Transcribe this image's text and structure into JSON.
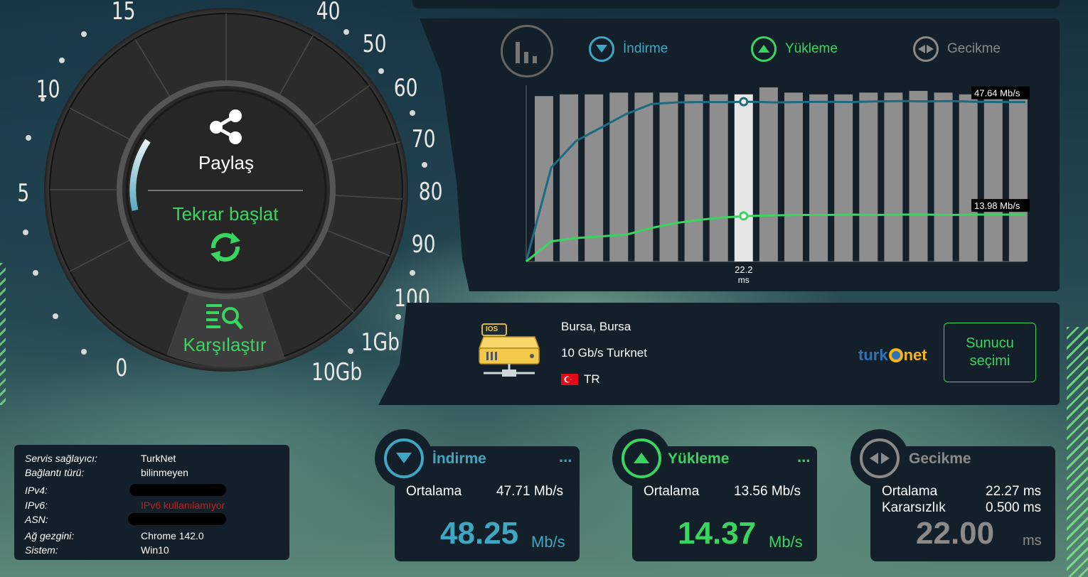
{
  "gauge": {
    "ticks": [
      "0",
      "5",
      "10",
      "15",
      "40",
      "50",
      "60",
      "70",
      "80",
      "90",
      "100",
      "1Gb",
      "10Gb"
    ],
    "share_label": "Paylaş",
    "restart_label": "Tekrar başlat",
    "compare_label": "Karşılaştır"
  },
  "chart_tabs": {
    "download": "İndirme",
    "upload": "Yükleme",
    "latency": "Gecikme"
  },
  "chart_data": {
    "type": "bar",
    "bars": 20,
    "bar_values": [
      0.95,
      0.96,
      0.96,
      0.97,
      0.97,
      0.97,
      0.96,
      0.96,
      0.96,
      1.0,
      0.97,
      0.96,
      0.96,
      0.97,
      0.97,
      0.98,
      0.97,
      0.96,
      0.96,
      0.96
    ],
    "highlight_index": 8,
    "highlight_label": "22.2",
    "highlight_unit": "ms",
    "series": [
      {
        "name": "İndirme",
        "color": "#1d6b80",
        "end_label": "47.64 Mb/s",
        "values": [
          0,
          28,
          36,
          40,
          44,
          47,
          47.5,
          47.6,
          47.6,
          47.7,
          47.5,
          47.6,
          47.7,
          47.6,
          47.8,
          47.9,
          47.8,
          47.9,
          47.7,
          47.6,
          47.6
        ]
      },
      {
        "name": "Yükleme",
        "color": "#3ad561",
        "end_label": "13.98 Mb/s",
        "values": [
          0,
          6,
          7,
          7.5,
          8,
          10,
          11.5,
          12.5,
          13.2,
          13.6,
          13.8,
          13.9,
          13.9,
          14.0,
          13.9,
          14.0,
          14.0,
          13.9,
          14.0,
          14.0,
          13.98
        ]
      }
    ]
  },
  "server": {
    "city": "Bursa, Bursa",
    "name": "10 Gb/s Turknet",
    "country": "TR",
    "badge": "IOS",
    "logo_a": "turk",
    "logo_b": "net",
    "select_line1": "Sunucu",
    "select_line2": "seçimi"
  },
  "info": {
    "rows": [
      {
        "k": "Servis sağlayıcı:",
        "v": "TurkNet"
      },
      {
        "k": "Bağlantı türü:",
        "v": "bilinmeyen"
      },
      {
        "k": "IPv4:",
        "v": ""
      },
      {
        "k": "IPv6:",
        "v": "IPv6 kullanılamıyor"
      },
      {
        "k": "ASN:",
        "v": ""
      },
      {
        "k": "Ağ gezgini:",
        "v": "Chrome 142.0"
      },
      {
        "k": "Sistem:",
        "v": "Win10"
      }
    ]
  },
  "cards": {
    "download": {
      "title": "İndirme",
      "avg_label": "Ortalama",
      "avg": "47.71 Mb/s",
      "value": "48.25",
      "unit": "Mb/s",
      "more": "..."
    },
    "upload": {
      "title": "Yükleme",
      "avg_label": "Ortalama",
      "avg": "13.56 Mb/s",
      "value": "14.37",
      "unit": "Mb/s",
      "more": "..."
    },
    "latency": {
      "title": "Gecikme",
      "avg_label": "Ortalama",
      "avg": "22.27 ms",
      "jitter_label": "Kararsızlık",
      "jitter": "0.500 ms",
      "value": "22.00",
      "unit": "ms"
    }
  },
  "colors": {
    "accent_green": "#3ad561",
    "accent_blue": "#3fa6c4",
    "panel": "#142029",
    "latency_gray": "#8a8a8a"
  }
}
